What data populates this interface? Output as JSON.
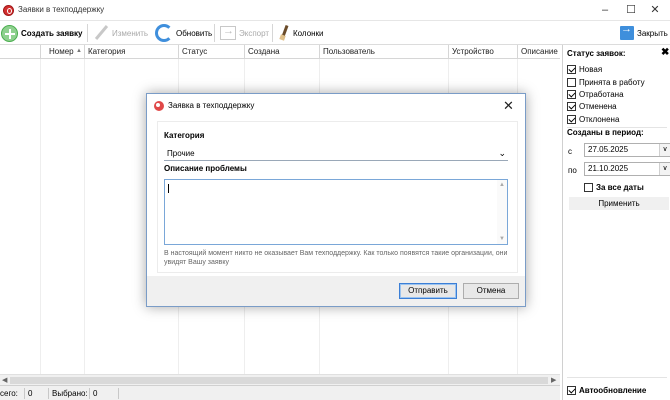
{
  "window": {
    "title": "Заявки в техподдержку"
  },
  "toolbar": {
    "create": "Создать заявку",
    "edit": "Изменить",
    "refresh": "Обновить",
    "export": "Экспорт",
    "columns": "Колонки",
    "close": "Закрыть"
  },
  "grid": {
    "columns": [
      "Номер",
      "Категория",
      "Статус",
      "Создана",
      "Пользователь",
      "Устройство",
      "Описание пр"
    ]
  },
  "statusbar": {
    "total_label": "сего:",
    "total_value": "0",
    "selected_label": "Выбрано:",
    "selected_value": "0"
  },
  "panel": {
    "status_title": "Статус заявок:",
    "statuses": [
      {
        "label": "Новая",
        "checked": true
      },
      {
        "label": "Принята в работу",
        "checked": false
      },
      {
        "label": "Отработана",
        "checked": true
      },
      {
        "label": "Отменена",
        "checked": true
      },
      {
        "label": "Отклонена",
        "checked": true
      }
    ],
    "period_title": "Созданы в период:",
    "from_label": "с",
    "from_date": "27.05.2025",
    "to_label": "по",
    "to_date": "21.10.2025",
    "all_dates": "За все даты",
    "apply": "Применить",
    "auto_update": "Автообновление"
  },
  "dialog": {
    "title": "Заявка в техподдержку",
    "category_label": "Категория",
    "category_value": "Прочие",
    "description_label": "Описание проблемы",
    "note": "В настоящий момент никто не оказывает Вам техподдержку. Как только появятся такие организации, они увидят Вашу заявку",
    "send": "Отправить",
    "cancel": "Отмена"
  }
}
